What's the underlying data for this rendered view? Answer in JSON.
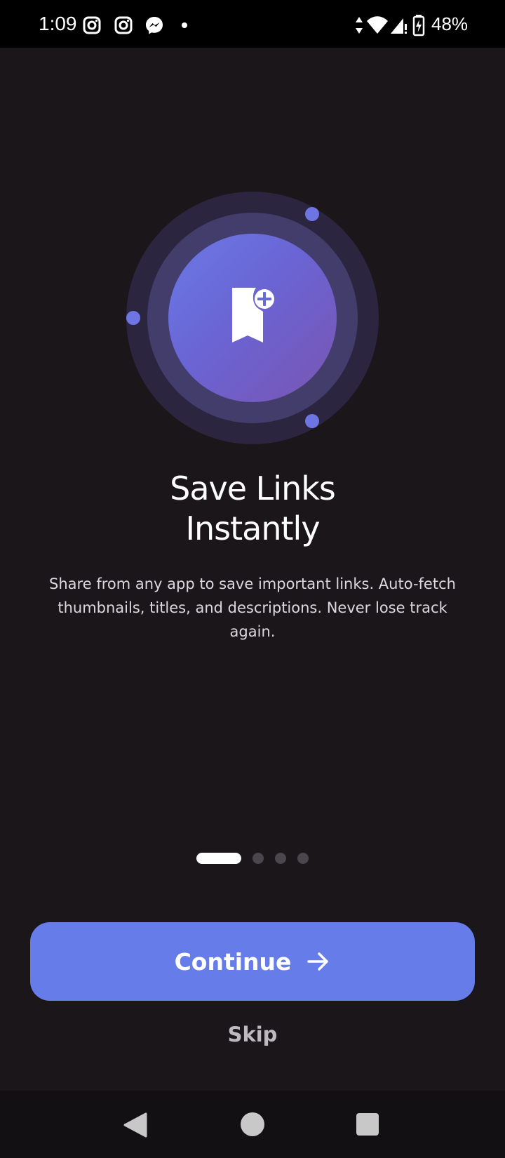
{
  "status_bar": {
    "time": "1:09",
    "battery_percent": "48%",
    "icons": [
      "instagram-icon",
      "instagram-icon",
      "messenger-icon",
      "notification-dot",
      "data-arrows-icon",
      "wifi-icon",
      "cell-signal-icon",
      "battery-charging-icon"
    ]
  },
  "hero": {
    "icon": "bookmark-add-icon",
    "colors": {
      "outer_ring": "#2b2540",
      "middle_ring": "#433d6c",
      "inner_circle_start": "#6b7ae6",
      "inner_circle_end": "#7a55b2",
      "orbit_dot": "#6e75e3"
    }
  },
  "onboarding": {
    "title_line1": "Save Links",
    "title_line2": "Instantly",
    "description": "Share from any app to save important links. Auto-fetch thumbnails, titles, and descriptions. Never lose track again.",
    "page_index": 1,
    "page_count": 4
  },
  "actions": {
    "continue_label": "Continue",
    "continue_icon": "arrow-right-icon",
    "skip_label": "Skip",
    "accent_color": "#667de9"
  },
  "nav_bar": {
    "buttons": [
      "back-icon",
      "home-icon",
      "recents-icon"
    ]
  }
}
